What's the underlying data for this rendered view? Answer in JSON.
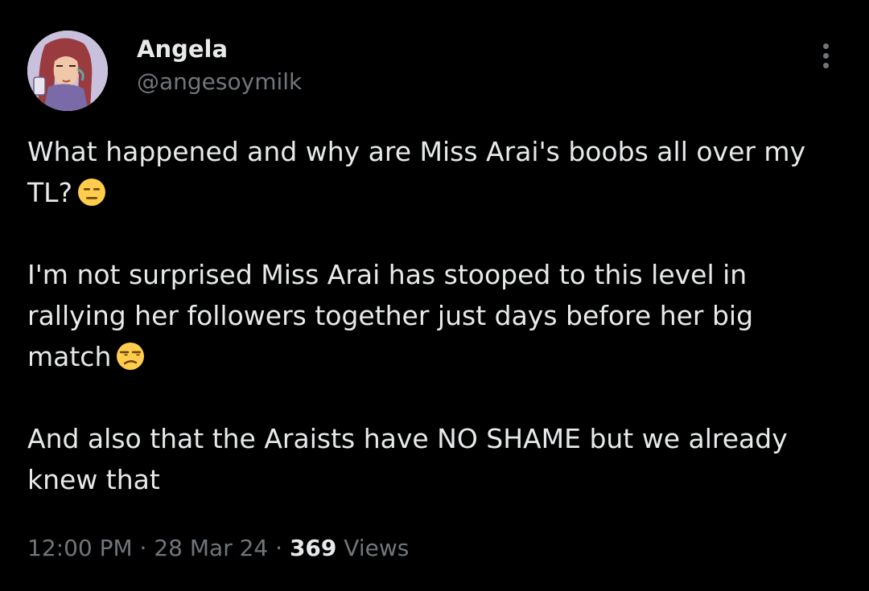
{
  "tweet": {
    "author": {
      "display_name": "Angela",
      "handle": "@angesoymilk",
      "avatar_icon": "avatar-illustration"
    },
    "more_icon": "more-vertical-icon",
    "paragraphs": [
      {
        "text": "What happened and why are Miss Arai's boobs all over my TL?",
        "emoji": "expressionless-face-emoji"
      },
      {
        "text": "I'm not surprised Miss Arai has stooped to this level in rallying her followers together just days before her big match",
        "emoji": "unamused-face-emoji"
      },
      {
        "text": "And also that the Araists have NO SHAME but we already knew that",
        "emoji": ""
      }
    ],
    "meta": {
      "time": "12:00 PM",
      "separator": " · ",
      "date": "28 Mar 24",
      "views_count": "369",
      "views_label": " Views"
    }
  },
  "colors": {
    "background": "#000000",
    "primary_text": "#e7e9ea",
    "secondary_text": "#71767b",
    "emoji_yellow": "#ffcc4d"
  }
}
